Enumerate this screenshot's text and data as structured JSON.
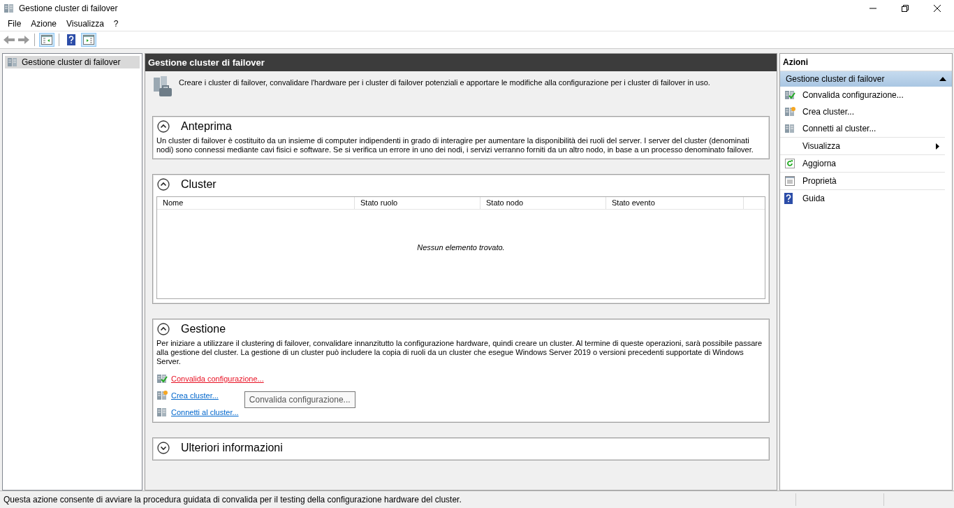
{
  "window": {
    "title": "Gestione cluster di failover"
  },
  "menu": [
    "File",
    "Azione",
    "Visualizza",
    "?"
  ],
  "toolbar": [
    {
      "kind": "back",
      "disabled": true
    },
    {
      "kind": "forward",
      "disabled": true
    },
    {
      "kind": "tree",
      "pressed": true
    },
    {
      "kind": "help",
      "pressed": false
    },
    {
      "kind": "pane",
      "pressed": true
    }
  ],
  "tree": {
    "items": [
      {
        "label": "Gestione cluster di failover",
        "selected": true
      }
    ]
  },
  "header": {
    "title": "Gestione cluster di failover",
    "description": "Creare i cluster di failover, convalidare l'hardware per i cluster di failover potenziali e apportare le modifiche alla configurazione per i cluster di failover in uso."
  },
  "sections": [
    {
      "kind": "text",
      "title": "Anteprima",
      "expanded": true,
      "text": "Un cluster di failover è costituito da un insieme di computer indipendenti in grado di interagire per aumentare la disponibilità dei ruoli del server. I server del cluster (denominati nodi) sono connessi mediante cavi fisici e software. Se si verifica un errore in uno dei nodi, i servizi verranno forniti da un altro nodo, in base a un processo denominato failover."
    },
    {
      "kind": "table",
      "title": "Cluster",
      "expanded": true,
      "columns": [
        "Nome",
        "Stato ruolo",
        "Stato nodo",
        "Stato evento"
      ],
      "empty_message": "Nessun elemento trovato."
    },
    {
      "kind": "links",
      "title": "Gestione",
      "expanded": true,
      "text": "Per iniziare a utilizzare il clustering di failover, convalidare innanzitutto la configurazione hardware, quindi creare un cluster. Al termine di queste operazioni, sarà possibile passare alla gestione del cluster. La gestione di un cluster può includere la copia di ruoli da un cluster che esegue Windows Server 2019 o versioni precedenti supportate di Windows Server.",
      "links": [
        {
          "label": "Convalida configurazione...",
          "kind": "validate",
          "hovered": true
        },
        {
          "label": "Crea cluster...",
          "kind": "create",
          "hovered": false
        },
        {
          "label": "Connetti al cluster...",
          "kind": "connect",
          "hovered": false
        }
      ],
      "tooltip": "Convalida configurazione..."
    },
    {
      "kind": "text",
      "title": "Ulteriori informazioni",
      "expanded": false
    }
  ],
  "actions": {
    "title": "Azioni",
    "group": {
      "title": "Gestione cluster di failover",
      "expanded": true
    },
    "items": [
      {
        "label": "Convalida configurazione...",
        "kind": "validate",
        "submenu": false
      },
      {
        "label": "Crea cluster...",
        "kind": "create",
        "submenu": false
      },
      {
        "label": "Connetti al cluster...",
        "kind": "connect",
        "submenu": false
      },
      {
        "label": "Visualizza",
        "kind": "submenu",
        "submenu": true
      },
      {
        "label": "Aggiorna",
        "kind": "refresh",
        "submenu": false
      },
      {
        "label": "Proprietà",
        "kind": "properties",
        "submenu": false
      },
      {
        "label": "Guida",
        "kind": "help",
        "submenu": false
      }
    ]
  },
  "status_bar": {
    "text": "Questa azione consente di avviare la procedura guidata di convalida per il testing della configurazione hardware del cluster."
  }
}
